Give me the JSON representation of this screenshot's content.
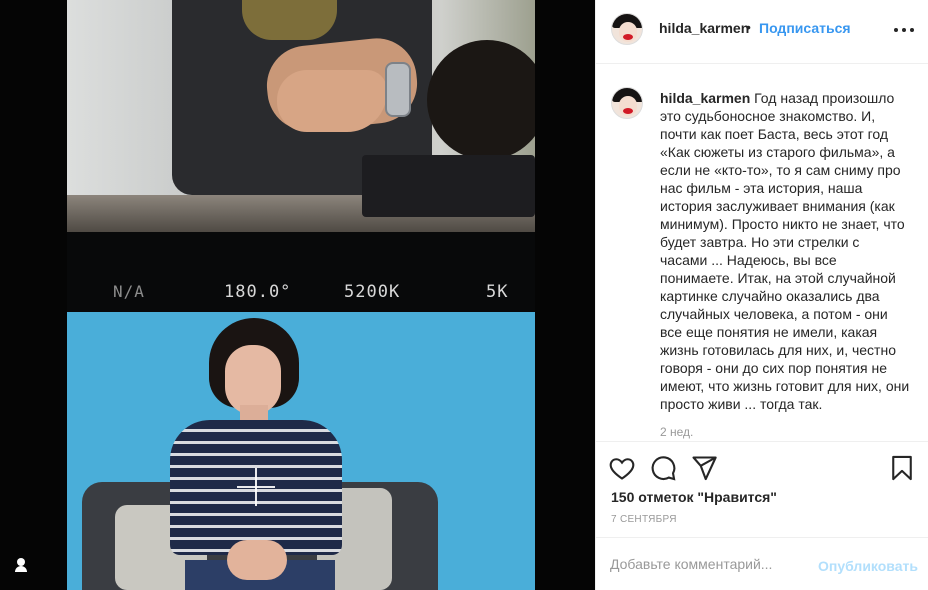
{
  "header": {
    "username": "hilda_karmen",
    "separator": "•",
    "follow_label": "Подписаться",
    "more_icon": "more-horizontal-icon"
  },
  "media": {
    "camera_overlay": {
      "left": "N/A",
      "shutter_angle": "180.0°",
      "white_balance": "5200K",
      "resolution": "5K"
    },
    "user_tag_icon": "person-icon"
  },
  "post": {
    "author": "hilda_karmen",
    "caption": "Год назад произошло это судьбоносное знакомство. И, почти как поет Баста, весь этот год «Как сюжеты из старого фильма», а если не «кто-то», то я сам сниму про нас фильм - эта история, наша история заслуживает внимания (как минимум). Просто никто не знает, что будет завтра. Но эти стрелки с часами ... Надеюсь, вы все понимаете. Итак, на этой случайной картинке случайно оказались два случайных человека, а потом - они все еще понятия не имели, какая жизнь готовилась для них, и, честно говоря - они до сих пор понятия не имеют, что жизнь готовит для них, они просто живи ... тогда так.",
    "time_ago": "2 нед."
  },
  "actions": {
    "likes": "150 отметок \"Нравится\"",
    "date": "7 СЕНТЯБРЯ",
    "icons": [
      "heart-icon",
      "comment-icon",
      "share-icon",
      "bookmark-icon"
    ]
  },
  "comment": {
    "placeholder": "Добавьте комментарий...",
    "publish_label": "Опубликовать"
  },
  "colors": {
    "accent": "#3897f0",
    "publish_disabled": "#b2dffc",
    "text": "#262626",
    "muted": "#999999"
  }
}
